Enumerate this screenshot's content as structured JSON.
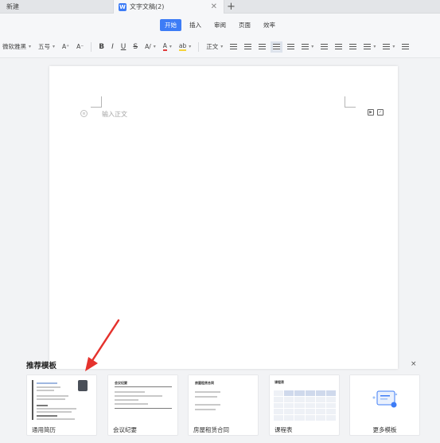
{
  "tabs": {
    "new_tab": "新建",
    "doc_tab": "文字文稿(2)",
    "doc_icon": "W",
    "close": "✕",
    "plus": "+"
  },
  "menu": [
    "开始",
    "插入",
    "审阅",
    "页面",
    "效率"
  ],
  "toolbar": {
    "font_name": "微软雅黑",
    "font_size": "五号",
    "grow": "A⁺",
    "shrink": "A⁻",
    "bold": "B",
    "italic": "I",
    "underline": "U",
    "strike": "S",
    "superscript": "A/",
    "font_color": "A",
    "highlight": "ab",
    "style": "正文"
  },
  "document": {
    "placeholder": "输入正文",
    "para_marker": "≡"
  },
  "templates": {
    "title": "推荐模板",
    "close": "×",
    "items": [
      {
        "label": "通用简历"
      },
      {
        "label": "会议纪要",
        "thumb_title": "会议纪要"
      },
      {
        "label": "房屋租赁合同",
        "thumb_title": "房屋租赁合同"
      },
      {
        "label": "课程表",
        "thumb_title": "课程表"
      },
      {
        "label": "更多模板"
      }
    ]
  },
  "colors": {
    "accent": "#3d7cf6",
    "arrow": "#e5322d"
  }
}
